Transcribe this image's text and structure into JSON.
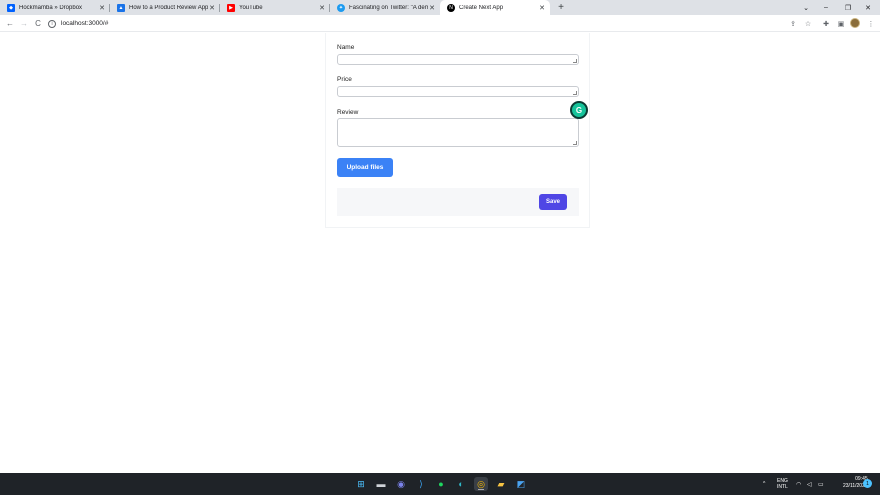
{
  "browser": {
    "tabs": [
      {
        "label": "Hockmamba » Dropbox",
        "icon": "dropbox-icon",
        "color": "#0061fe"
      },
      {
        "label": "How to a Product Review Applic",
        "icon": "graduation-cap-icon",
        "color": "#1a73e8"
      },
      {
        "label": "YouTube",
        "icon": "youtube-icon",
        "color": "#ff0000"
      },
      {
        "label": "Fascinating on Twitter: \"A demo",
        "icon": "twitter-icon",
        "color": "#1d9bf0"
      },
      {
        "label": "Create Next App",
        "icon": "nextjs-icon",
        "color": "#000000"
      }
    ],
    "new_tab": "+",
    "window_controls": [
      "⌄",
      "–",
      "❐",
      "✕"
    ],
    "address": "localhost:3000/#",
    "nav": [
      "←",
      "→",
      "C"
    ]
  },
  "form": {
    "name_label": "Name",
    "name_value": "",
    "price_label": "Price",
    "price_value": "",
    "review_label": "Review",
    "review_value": "",
    "upload_label": "Upload files",
    "save_label": "Save"
  },
  "grammarly_badge": "G",
  "taskbar": {
    "apps": [
      "windows-start-icon",
      "file-explorer-icon",
      "chat-icon",
      "vscode-icon",
      "spotify-icon",
      "edge-icon",
      "chrome-icon",
      "folder-icon",
      "paint-icon"
    ],
    "tray_chevron": "^",
    "language": "ENG",
    "layout": "INTL",
    "time": "09:45",
    "date": "23/11/2022",
    "notifications": "1"
  },
  "colors": {
    "upload_button": "#3b82f6",
    "save_button": "#4f46e5",
    "grammarly": "#15c39a"
  }
}
